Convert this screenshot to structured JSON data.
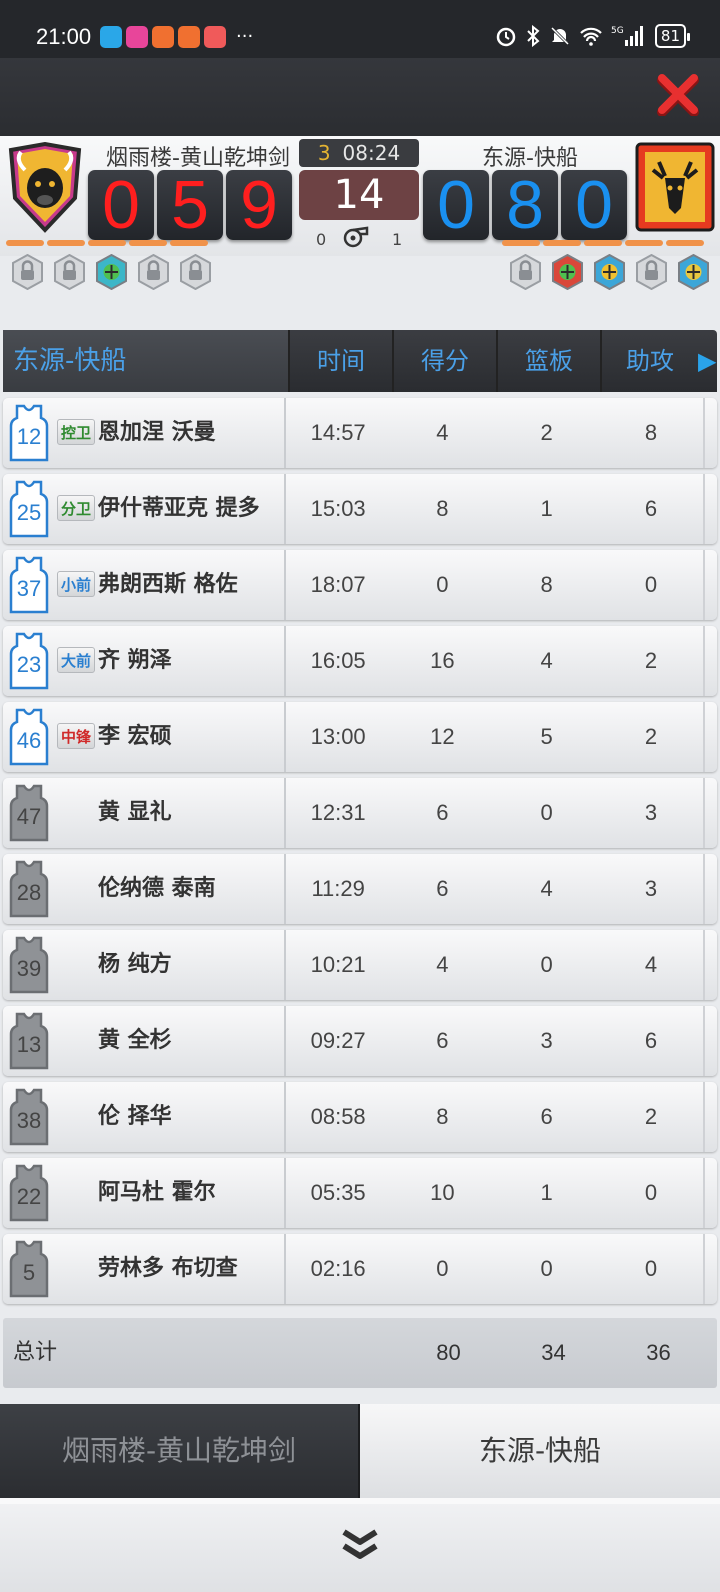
{
  "status": {
    "time": "21:00",
    "dots": "···",
    "battery": "81",
    "net": "5G"
  },
  "colors": {
    "home_score": "#ff1f1f",
    "away_score": "#1a90f0",
    "header_text": "#4aa0e8",
    "foul": "#f0924a"
  },
  "scoreboard": {
    "home_team": "烟雨楼-黄山乾坤剑",
    "away_team": "东源-快船",
    "home_digits": [
      "0",
      "5",
      "9"
    ],
    "away_digits": [
      "0",
      "8",
      "0"
    ],
    "quarter": "3",
    "game_clock": "08:24",
    "shot_clock": "14",
    "home_timeouts_used": "0",
    "away_timeouts_used": "1"
  },
  "table": {
    "team": "东源-快船",
    "headers": [
      "时间",
      "得分",
      "篮板",
      "助攻"
    ],
    "players": [
      {
        "num": "12",
        "pos": "控卫",
        "name": "恩加涅 沃曼",
        "time": "14:57",
        "pts": "4",
        "reb": "2",
        "ast": "8",
        "starter": true,
        "pos_color": "#2f8a2f"
      },
      {
        "num": "25",
        "pos": "分卫",
        "name": "伊什蒂亚克 提多",
        "time": "15:03",
        "pts": "8",
        "reb": "1",
        "ast": "6",
        "starter": true,
        "pos_color": "#2f8a2f"
      },
      {
        "num": "37",
        "pos": "小前",
        "name": "弗朗西斯 格佐",
        "time": "18:07",
        "pts": "0",
        "reb": "8",
        "ast": "0",
        "starter": true,
        "pos_color": "#2a7fd0"
      },
      {
        "num": "23",
        "pos": "大前",
        "name": "齐 朔泽",
        "time": "16:05",
        "pts": "16",
        "reb": "4",
        "ast": "2",
        "starter": true,
        "pos_color": "#2a7fd0"
      },
      {
        "num": "46",
        "pos": "中锋",
        "name": "李 宏硕",
        "time": "13:00",
        "pts": "12",
        "reb": "5",
        "ast": "2",
        "starter": true,
        "pos_color": "#d02a2a"
      },
      {
        "num": "47",
        "pos": "",
        "name": "黄 显礼",
        "time": "12:31",
        "pts": "6",
        "reb": "0",
        "ast": "3",
        "starter": false
      },
      {
        "num": "28",
        "pos": "",
        "name": "伦纳德 泰南",
        "time": "11:29",
        "pts": "6",
        "reb": "4",
        "ast": "3",
        "starter": false
      },
      {
        "num": "39",
        "pos": "",
        "name": "杨 纯方",
        "time": "10:21",
        "pts": "4",
        "reb": "0",
        "ast": "4",
        "starter": false
      },
      {
        "num": "13",
        "pos": "",
        "name": "黄 全杉",
        "time": "09:27",
        "pts": "6",
        "reb": "3",
        "ast": "6",
        "starter": false
      },
      {
        "num": "38",
        "pos": "",
        "name": "伦 择华",
        "time": "08:58",
        "pts": "8",
        "reb": "6",
        "ast": "2",
        "starter": false
      },
      {
        "num": "22",
        "pos": "",
        "name": "阿马杜 霍尔",
        "time": "05:35",
        "pts": "10",
        "reb": "1",
        "ast": "0",
        "starter": false
      },
      {
        "num": "5",
        "pos": "",
        "name": "劳林多 布切查",
        "time": "02:16",
        "pts": "0",
        "reb": "0",
        "ast": "0",
        "starter": false
      }
    ],
    "totals": {
      "label": "总计",
      "pts": "80",
      "reb": "34",
      "ast": "36"
    }
  },
  "tabs": {
    "home": "烟雨楼-黄山乾坤剑",
    "away": "东源-快船"
  },
  "icons": {
    "close": "close-icon",
    "expand": "double-chevron-down-icon"
  }
}
